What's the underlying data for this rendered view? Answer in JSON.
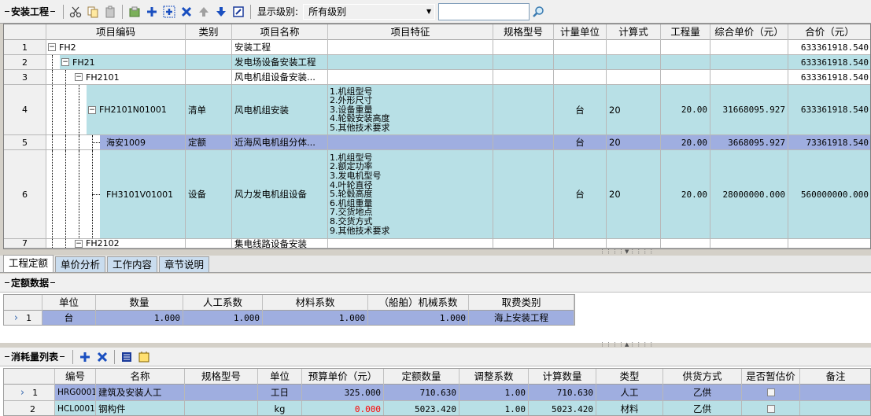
{
  "toolbar": {
    "section": "安装工程",
    "level_label": "显示级别:",
    "level_value": "所有级别",
    "search_value": ""
  },
  "main_grid": {
    "headers": [
      "",
      "项目编码",
      "类别",
      "项目名称",
      "项目特征",
      "规格型号",
      "计量单位",
      "计算式",
      "工程量",
      "综合单价（元）",
      "合价（元）"
    ],
    "rows": [
      {
        "n": "1",
        "code": "FH2",
        "type": "",
        "name": "安装工程",
        "feat": [],
        "spec": "",
        "unit": "",
        "formula": "",
        "qty": "",
        "price": "",
        "total": "633361918.540"
      },
      {
        "n": "2",
        "code": "FH21",
        "type": "",
        "name": "发电场设备安装工程",
        "feat": [],
        "spec": "",
        "unit": "",
        "formula": "",
        "qty": "",
        "price": "",
        "total": "633361918.540"
      },
      {
        "n": "3",
        "code": "FH2101",
        "type": "",
        "name": "风电机组设备安装...",
        "feat": [],
        "spec": "",
        "unit": "",
        "formula": "",
        "qty": "",
        "price": "",
        "total": "633361918.540"
      },
      {
        "n": "4",
        "code": "FH2101N01001",
        "type": "清单",
        "name": "风电机组安装",
        "feat": [
          "1.机组型号",
          "2.外形尺寸",
          "3.设备重量",
          "4.轮毂安装高度",
          "5.其他技术要求"
        ],
        "spec": "",
        "unit": "台",
        "formula": "20",
        "qty": "20.00",
        "price": "31668095.927",
        "total": "633361918.540"
      },
      {
        "n": "5",
        "code": "海安1009",
        "type": "定额",
        "name": "近海风电机组分体...",
        "feat": [],
        "spec": "",
        "unit": "台",
        "formula": "20",
        "qty": "20.00",
        "price": "3668095.927",
        "total": "73361918.540"
      },
      {
        "n": "6",
        "code": "FH3101V01001",
        "type": "设备",
        "name": "风力发电机组设备",
        "feat": [
          "1.机组型号",
          "2.额定功率",
          "3.发电机型号",
          "4.叶轮直径",
          "5.轮毂高度",
          "6.机组重量",
          "7.交货地点",
          "8.交货方式",
          "9.其他技术要求"
        ],
        "spec": "",
        "unit": "台",
        "formula": "20",
        "qty": "20.00",
        "price": "28000000.000",
        "total": "560000000.000"
      },
      {
        "n": "7",
        "code": "FH2102",
        "type": "",
        "name": "集电线路设备安装",
        "feat": [],
        "spec": "",
        "unit": "",
        "formula": "",
        "qty": "",
        "price": "",
        "total": ""
      }
    ]
  },
  "tabs": [
    "工程定额",
    "单价分析",
    "工作内容",
    "章节说明"
  ],
  "quota": {
    "section": "定额数据",
    "headers": [
      "",
      "单位",
      "数量",
      "人工系数",
      "材料系数",
      "（船舶）机械系数",
      "取费类别"
    ],
    "rows": [
      {
        "n": "1",
        "unit": "台",
        "qty": "1.000",
        "labor": "1.000",
        "mat": "1.000",
        "mach": "1.000",
        "fee": "海上安装工程"
      }
    ]
  },
  "consume": {
    "section": "消耗量列表",
    "headers": [
      "",
      "编号",
      "名称",
      "规格型号",
      "单位",
      "预算单价（元）",
      "定额数量",
      "调整系数",
      "计算数量",
      "类型",
      "供货方式",
      "是否暂估价",
      "备注"
    ],
    "rows": [
      {
        "n": "1",
        "code": "HRG0001",
        "name": "建筑及安装人工",
        "spec": "",
        "unit": "工日",
        "price": "325.000",
        "qty": "710.630",
        "adj": "1.00",
        "calc": "710.630",
        "type": "人工",
        "supply": "乙供",
        "est": false,
        "note": ""
      },
      {
        "n": "2",
        "code": "HCL0001",
        "name": "钢构件",
        "spec": "",
        "unit": "kg",
        "price": "0.000",
        "qty": "5023.420",
        "adj": "1.00",
        "calc": "5023.420",
        "type": "材料",
        "supply": "乙供",
        "est": false,
        "note": ""
      }
    ]
  },
  "colors": {
    "teal": "#b8e0e6",
    "sel": "#9faee0",
    "red": "#ff0000",
    "tab": "#c9dcee"
  }
}
